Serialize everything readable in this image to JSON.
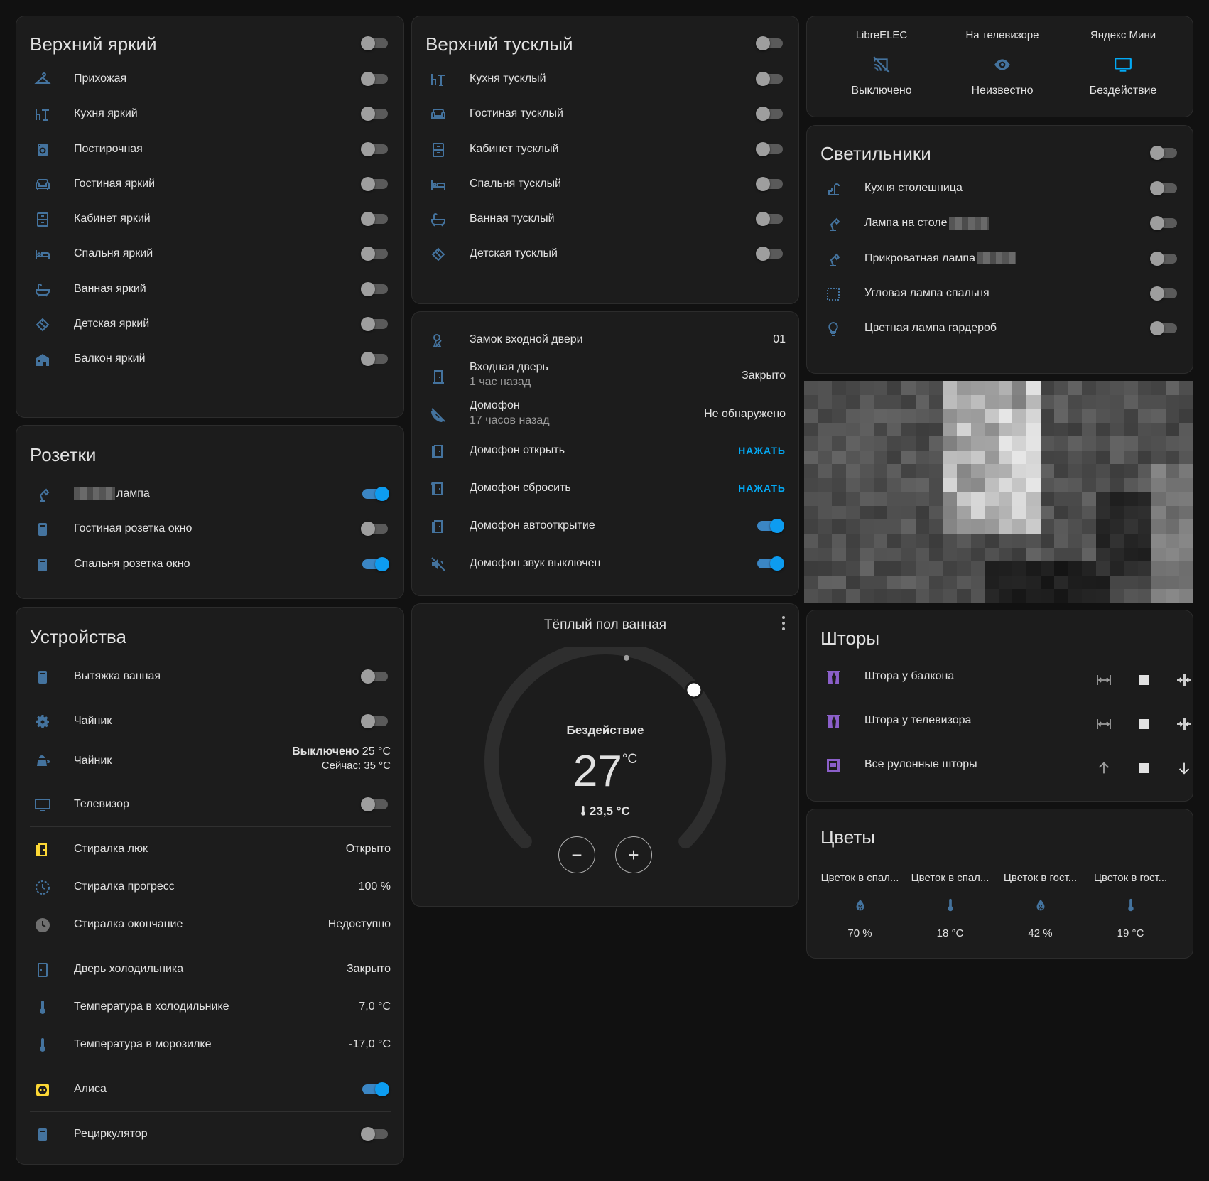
{
  "colors": {
    "accent": "#03a9f4",
    "icon": "#44739e",
    "toggle_on": "#0d9cf0",
    "card_bg": "#1c1c1c",
    "page_bg": "#111111",
    "curtain_icon": "#8b5fc9",
    "warn_icon": "#fdd835"
  },
  "upper_bright": {
    "title": "Верхний яркий",
    "items": [
      {
        "icon": "hanger-icon",
        "label": "Прихожая",
        "state": "off"
      },
      {
        "icon": "table-chair-icon",
        "label": "Кухня яркий",
        "state": "off"
      },
      {
        "icon": "washing-machine-icon",
        "label": "Постирочная",
        "state": "off"
      },
      {
        "icon": "sofa-icon",
        "label": "Гостиная яркий",
        "state": "off"
      },
      {
        "icon": "desk-icon",
        "label": "Кабинет яркий",
        "state": "off"
      },
      {
        "icon": "bed-icon",
        "label": "Спальня яркий",
        "state": "off"
      },
      {
        "icon": "bathtub-icon",
        "label": "Ванная яркий",
        "state": "off"
      },
      {
        "icon": "toy-brick-icon",
        "label": "Детская яркий",
        "state": "off"
      },
      {
        "icon": "balcony-icon",
        "label": "Балкон яркий",
        "state": "off"
      }
    ]
  },
  "upper_dim": {
    "title": "Верхний тусклый",
    "items": [
      {
        "icon": "table-chair-icon",
        "label": "Кухня тусклый",
        "state": "off"
      },
      {
        "icon": "sofa-icon",
        "label": "Гостиная тусклый",
        "state": "off"
      },
      {
        "icon": "desk-icon",
        "label": "Кабинет тусклый",
        "state": "off"
      },
      {
        "icon": "bed-icon",
        "label": "Спальня тусклый",
        "state": "off"
      },
      {
        "icon": "bathtub-icon",
        "label": "Ванная тусклый",
        "state": "off"
      },
      {
        "icon": "toy-brick-icon",
        "label": "Детская тусклый",
        "state": "off"
      }
    ]
  },
  "media": [
    {
      "name": "LibreELEC",
      "icon": "cast-off-icon",
      "state": "Выключено"
    },
    {
      "name": "На телевизоре",
      "icon": "eye-icon",
      "state": "Неизвестно"
    },
    {
      "name": "Яндекс Мини",
      "icon": "monitor-icon",
      "state": "Бездействие"
    }
  ],
  "lamps": {
    "title": "Светильники",
    "items": [
      {
        "icon": "faucet-lamp-icon",
        "label": "Кухня столешница",
        "state": "off"
      },
      {
        "icon": "desk-lamp-icon",
        "label": "Лампа на столе",
        "state": "off"
      },
      {
        "icon": "desk-lamp-icon",
        "label": "Прикроватная лампа",
        "state": "off"
      },
      {
        "icon": "dotted-square-icon",
        "label": "Угловая лампа спальня",
        "state": "off"
      },
      {
        "icon": "lightbulb-icon",
        "label": "Цветная лампа гардероб",
        "state": "off"
      }
    ]
  },
  "sockets": {
    "title": "Розетки",
    "items": [
      {
        "icon": "desk-lamp-icon",
        "label": "лампа",
        "state": "on"
      },
      {
        "icon": "socket-icon",
        "label": "Гостиная розетка окно",
        "state": "off"
      },
      {
        "icon": "socket-icon",
        "label": "Спальня розетка окно",
        "state": "on"
      }
    ]
  },
  "door": {
    "lock": {
      "label": "Замок входной двери",
      "value": "01"
    },
    "front_door": {
      "label": "Входная дверь",
      "secondary": "1 час назад",
      "value": "Закрыто"
    },
    "intercom": {
      "label": "Домофон",
      "secondary": "17 часов назад",
      "value": "Не обнаружено"
    },
    "open": {
      "label": "Домофон открыть",
      "action": "НАЖАТЬ"
    },
    "reset": {
      "label": "Домофон сбросить",
      "action": "НАЖАТЬ"
    },
    "auto_open": {
      "label": "Домофон автооткрытие",
      "state": "on"
    },
    "mute": {
      "label": "Домофон звук выключен",
      "state": "on"
    }
  },
  "thermostat": {
    "title": "Тёплый пол ванная",
    "mode": "Бездействие",
    "target": "27",
    "unit": "°C",
    "current": "23,5 °C",
    "target_fraction": 0.55,
    "minus": "−",
    "plus": "+"
  },
  "curtains": {
    "title": "Шторы",
    "items": [
      {
        "label": "Штора у балкона"
      },
      {
        "label": "Штора у телевизора"
      },
      {
        "label": "Все рулонные шторы"
      }
    ]
  },
  "plants": {
    "title": "Цветы",
    "items": [
      {
        "name": "Цветок в спал...",
        "icon": "water-percent-icon",
        "value": "70 %"
      },
      {
        "name": "Цветок в спал...",
        "icon": "thermometer-icon",
        "value": "18 °C"
      },
      {
        "name": "Цветок в гост...",
        "icon": "water-percent-icon",
        "value": "42 %"
      },
      {
        "name": "Цветок в гост...",
        "icon": "thermometer-icon",
        "value": "19 °C"
      }
    ]
  },
  "devices": {
    "title": "Устройства",
    "hood": {
      "label": "Вытяжка ванная",
      "state": "off"
    },
    "kettle_switch": {
      "label": "Чайник",
      "state": "off"
    },
    "kettle_climate": {
      "label": "Чайник",
      "state_text": "Выключено",
      "target": "25 °C",
      "current": "Сейчас: 35 °C"
    },
    "tv": {
      "label": "Телевизор",
      "state": "off"
    },
    "washer_door": {
      "label": "Стиралка люк",
      "value": "Открыто"
    },
    "washer_progress": {
      "label": "Стиралка прогресс",
      "value": "100 %"
    },
    "washer_end": {
      "label": "Стиралка окончание",
      "value": "Недоступно"
    },
    "fridge_door": {
      "label": "Дверь холодильника",
      "value": "Закрыто"
    },
    "fridge_temp": {
      "label": "Температура в холодильнике",
      "value": "7,0 °C"
    },
    "freezer_temp": {
      "label": "Температура в морозилке",
      "value": "-17,0 °C"
    },
    "alice": {
      "label": "Алиса",
      "state": "on"
    },
    "recirculator": {
      "label": "Рециркулятор",
      "state": "off"
    }
  }
}
